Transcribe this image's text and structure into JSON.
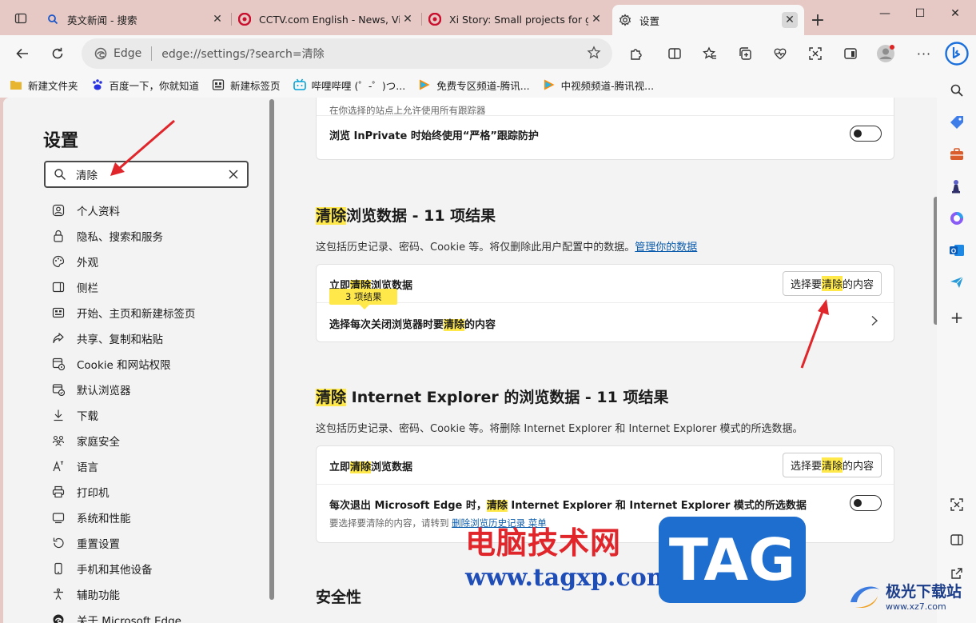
{
  "tabs": [
    {
      "title": "英文新闻 - 搜索",
      "icon": "search-icon"
    },
    {
      "title": "CCTV.com English - News, Videos",
      "icon": "cctv-icon"
    },
    {
      "title": "Xi Story: Small projects for greater",
      "icon": "cctv-icon"
    },
    {
      "title": "设置",
      "icon": "gear-icon",
      "active": true
    }
  ],
  "address": {
    "chip": "Edge",
    "url": "edge://settings/?search=清除"
  },
  "bookmarks": [
    {
      "label": "新建文件夹",
      "icon": "folder-icon"
    },
    {
      "label": "百度一下，你就知道",
      "icon": "baidu-icon"
    },
    {
      "label": "新建标签页",
      "icon": "newtab-icon"
    },
    {
      "label": "哔哩哔哩 (゜-゜)つ...",
      "icon": "bilibili-icon"
    },
    {
      "label": "免费专区频道-腾讯...",
      "icon": "tencent-video-icon"
    },
    {
      "label": "中视频频道-腾讯视...",
      "icon": "tencent-video-icon"
    }
  ],
  "nav": {
    "title": "设置",
    "search_value": "清除",
    "items": [
      {
        "label": "个人资料",
        "icon": "profile-icon"
      },
      {
        "label": "隐私、搜索和服务",
        "icon": "lock-icon"
      },
      {
        "label": "外观",
        "icon": "palette-icon"
      },
      {
        "label": "侧栏",
        "icon": "sidebar-icon"
      },
      {
        "label": "开始、主页和新建标签页",
        "icon": "home-icon"
      },
      {
        "label": "共享、复制和粘贴",
        "icon": "share-icon"
      },
      {
        "label": "Cookie 和网站权限",
        "icon": "cookie-icon"
      },
      {
        "label": "默认浏览器",
        "icon": "browser-icon"
      },
      {
        "label": "下载",
        "icon": "download-icon"
      },
      {
        "label": "家庭安全",
        "icon": "family-icon"
      },
      {
        "label": "语言",
        "icon": "language-icon"
      },
      {
        "label": "打印机",
        "icon": "printer-icon"
      },
      {
        "label": "系统和性能",
        "icon": "system-icon"
      },
      {
        "label": "重置设置",
        "icon": "reset-icon"
      },
      {
        "label": "手机和其他设备",
        "icon": "phone-icon"
      },
      {
        "label": "辅助功能",
        "icon": "accessibility-icon"
      },
      {
        "label": "关于 Microsoft Edge",
        "icon": "edge-icon"
      }
    ]
  },
  "tracking_card": {
    "note": "在你选择的站点上允许使用所有跟踪器",
    "inprivate_label": "浏览 InPrivate 时始终使用“严格”跟踪防护"
  },
  "clear_section": {
    "title_hl": "清除",
    "title_rest": "浏览数据 - 11 项结果",
    "desc": "这包括历史记录、密码、Cookie 等。将仅删除此用户配置中的数据。",
    "manage_link": "管理你的数据",
    "row1_pre": "立即",
    "row1_hl": "清除",
    "row1_post": "浏览数据",
    "tooltip": "3 项结果",
    "button_pre": "选择要",
    "button_hl": "清除",
    "button_post": "的内容",
    "row2_pre": "选择每次关闭浏览器时要",
    "row2_hl": "清除",
    "row2_post": "的内容"
  },
  "ie_section": {
    "title_hl": "清除",
    "title_rest": " Internet Explorer 的浏览数据 - 11 项结果",
    "desc": "这包括历史记录、密码、Cookie 等。将删除 Internet Explorer 和 Internet Explorer 模式的所选数据。",
    "row1_pre": "立即",
    "row1_hl": "清除",
    "row1_post": "浏览数据",
    "button_pre": "选择要",
    "button_hl": "清除",
    "button_post": "的内容",
    "row2_pre": "每次退出 Microsoft Edge 时，",
    "row2_hl": "清除",
    "row2_post": " Internet Explorer 和 Internet Explorer 模式的所选数据",
    "row2_sub_pre": "要选择要清除的内容，请转到 ",
    "row2_sub_link": "删除浏览历史记录 菜单"
  },
  "security_title": "安全性",
  "watermark": {
    "text": "电脑技术网",
    "url": "www.tagxp.com",
    "tag": "TAG",
    "brand": "极光下载站",
    "brand_url": "www.xz7.com"
  },
  "colors": {
    "highlight": "#ffe94a",
    "link": "#0b5cad",
    "annotation_arrow": "#e0262b"
  }
}
